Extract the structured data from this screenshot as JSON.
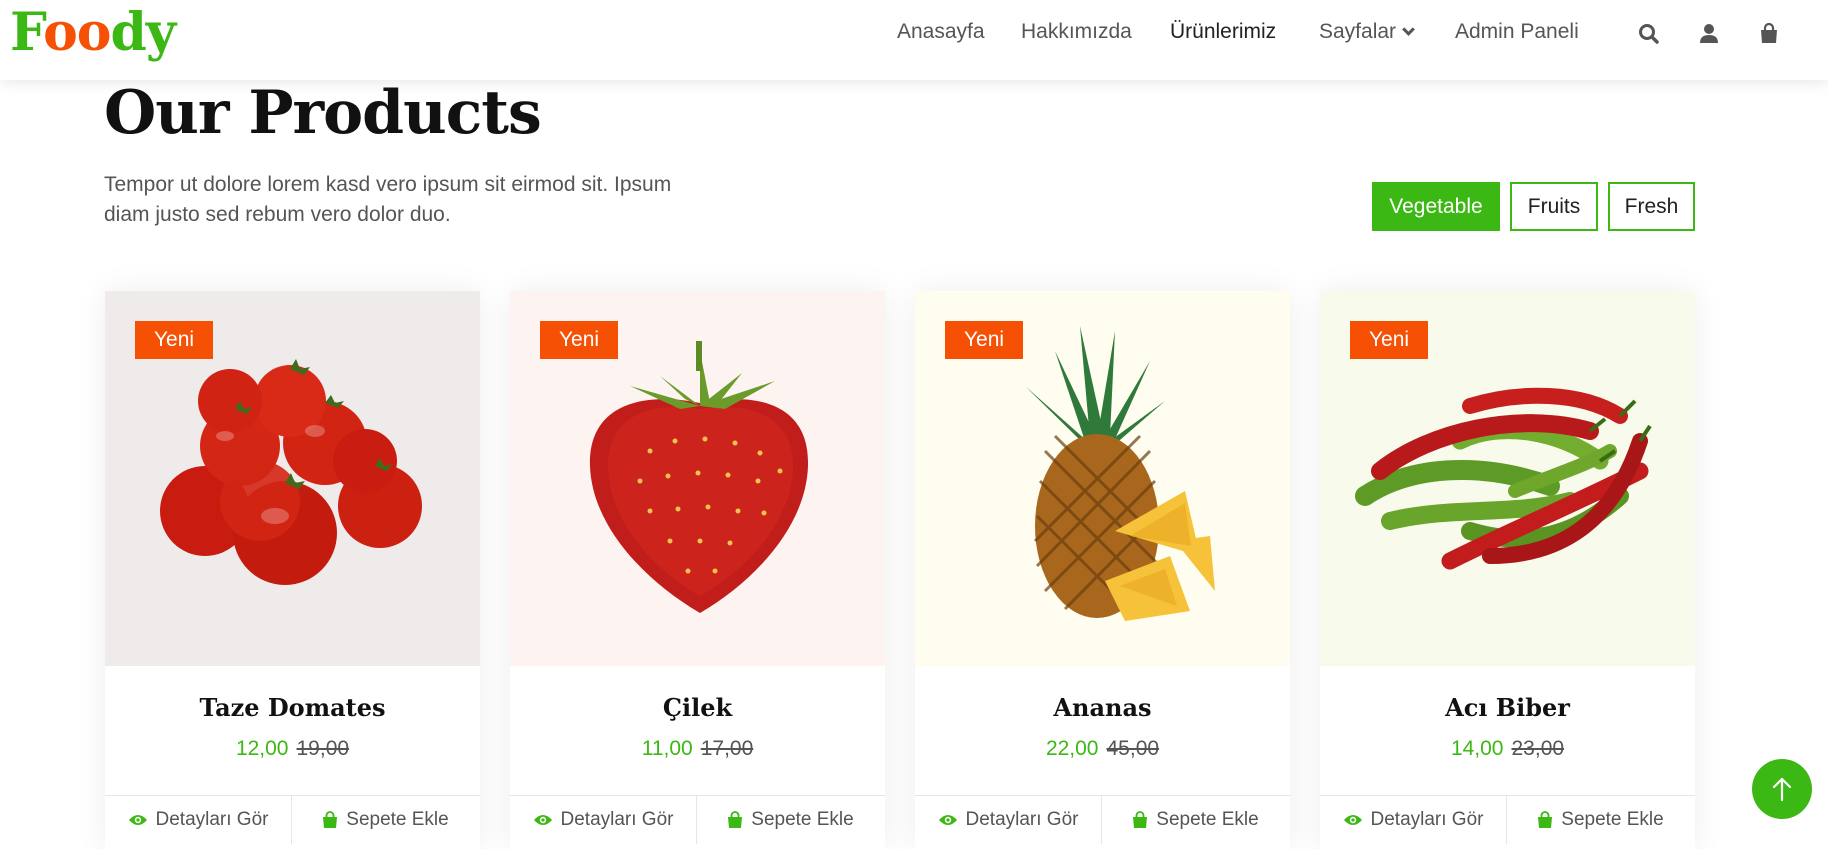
{
  "brand": {
    "letters": [
      "F",
      "o",
      "o",
      "d",
      "y"
    ]
  },
  "nav": {
    "items": [
      {
        "label": "Anasayfa"
      },
      {
        "label": "Hakkımızda"
      },
      {
        "label": "Ürünlerimiz"
      },
      {
        "label": "Sayfalar"
      },
      {
        "label": "Admin Paneli"
      }
    ],
    "active": "Ürünlerimiz",
    "icons": [
      "search-icon",
      "user-icon",
      "shopping-bag-icon"
    ]
  },
  "section": {
    "title": "Our Products",
    "description": "Tempor ut dolore lorem kasd vero ipsum sit eirmod sit. Ipsum diam justo sed rebum vero dolor duo.",
    "filters": [
      {
        "label": "Vegetable",
        "active": true
      },
      {
        "label": "Fruits",
        "active": false
      },
      {
        "label": "Fresh",
        "active": false
      }
    ]
  },
  "products": [
    {
      "badge": "Yeni",
      "name": "Taze Domates",
      "price": "12,00",
      "old_price": "19,00",
      "details_label": "Detayları Gör",
      "cart_label": "Sepete Ekle",
      "image": "tomatoes",
      "bg": "#efebeb"
    },
    {
      "badge": "Yeni",
      "name": "Çilek",
      "price": "11,00",
      "old_price": "17,00",
      "details_label": "Detayları Gör",
      "cart_label": "Sepete Ekle",
      "image": "strawberry",
      "bg": "#fdf4f2"
    },
    {
      "badge": "Yeni",
      "name": "Ananas",
      "price": "22,00",
      "old_price": "45,00",
      "details_label": "Detayları Gör",
      "cart_label": "Sepete Ekle",
      "image": "pineapple",
      "bg": "#fefdf0"
    },
    {
      "badge": "Yeni",
      "name": "Acı Biber",
      "price": "14,00",
      "old_price": "23,00",
      "details_label": "Detayları Gör",
      "cart_label": "Sepete Ekle",
      "image": "chili-peppers",
      "bg": "#f8faec"
    }
  ],
  "colors": {
    "primary": "#3cb815",
    "accent": "#f65005",
    "text": "#555555",
    "heading": "#111111"
  },
  "back_to_top_icon": "arrow-up-icon"
}
